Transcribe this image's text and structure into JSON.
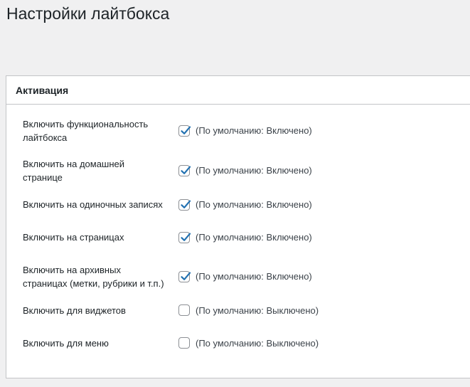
{
  "page": {
    "title": "Настройки лайтбокса"
  },
  "section": {
    "title": "Активация"
  },
  "settings": [
    {
      "label": "Включить функциональность лайтбокса",
      "checked": true,
      "note": "(По умолчанию: Включено)"
    },
    {
      "label": "Включить на домашней странице",
      "checked": true,
      "note": "(По умолчанию: Включено)"
    },
    {
      "label": "Включить на одиночных записях",
      "checked": true,
      "note": "(По умолчанию: Включено)"
    },
    {
      "label": "Включить на страницах",
      "checked": true,
      "note": "(По умолчанию: Включено)"
    },
    {
      "label": "Включить на архивных страницах (метки, рубрики и т.п.)",
      "checked": true,
      "note": "(По умолчанию: Включено)"
    },
    {
      "label": "Включить для виджетов",
      "checked": false,
      "note": "(По умолчанию: Выключено)"
    },
    {
      "label": "Включить для меню",
      "checked": false,
      "note": "(По умолчанию: Выключено)"
    }
  ],
  "colors": {
    "accent": "#2271b1",
    "border": "#8c8f94",
    "background": "#f0f0f1"
  }
}
